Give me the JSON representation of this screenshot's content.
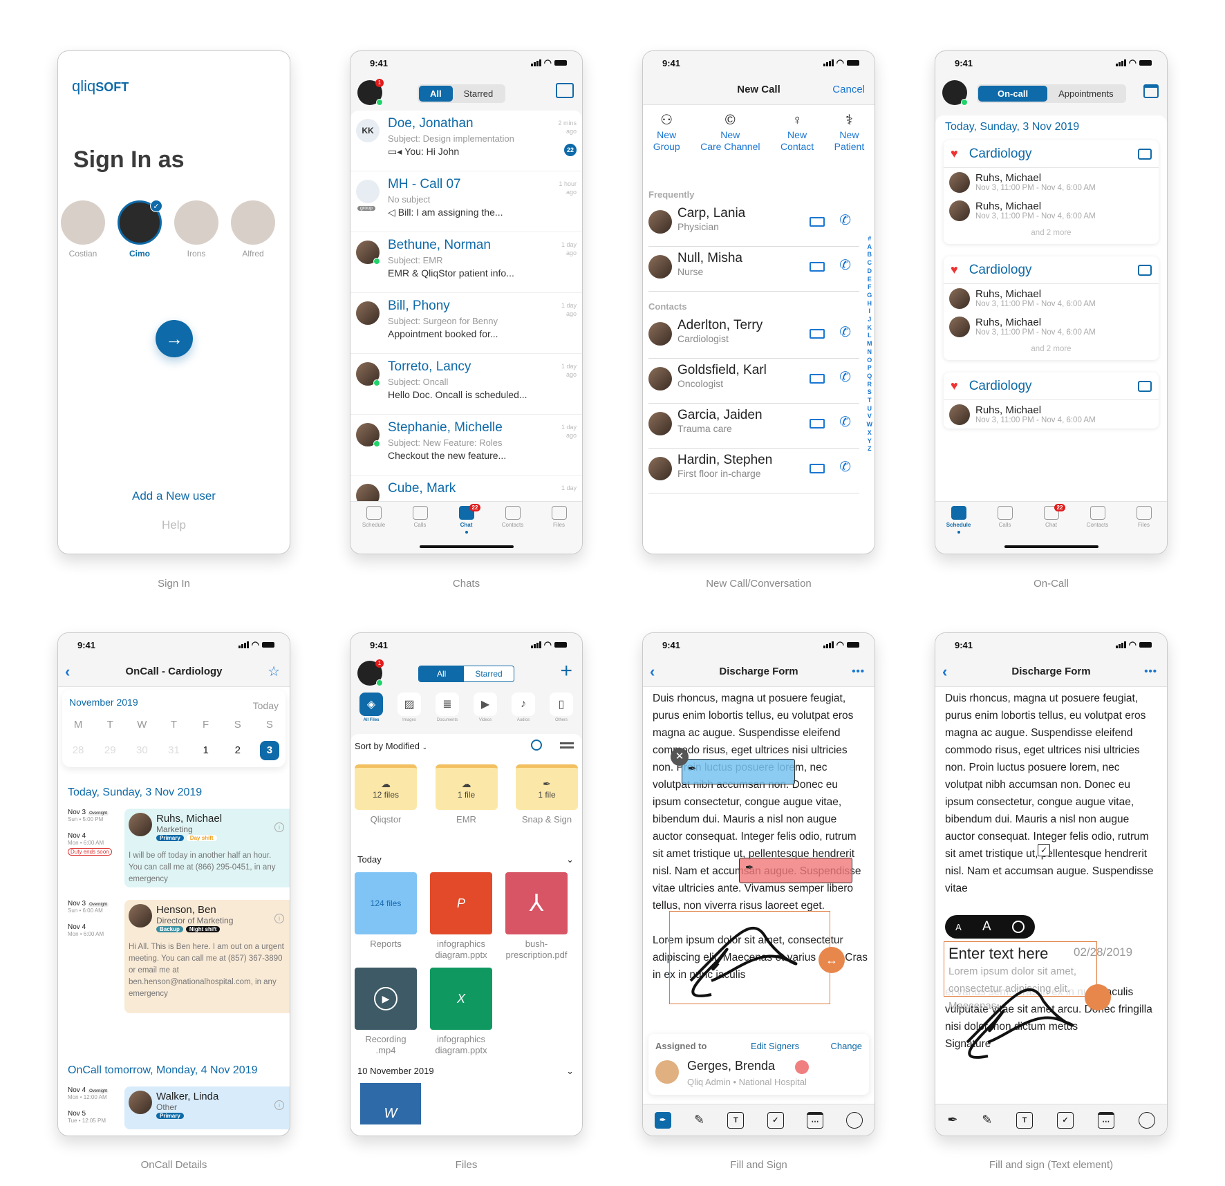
{
  "status_time": "9:41",
  "captions": [
    "Sign In",
    "Chats",
    "New Call/Conversation",
    "On-Call",
    "OnCall Details",
    "Files",
    "Fill and Sign",
    "Fill and sign (Text element)"
  ],
  "signin": {
    "logo_a": "qliq",
    "logo_b": "SOFT",
    "title": "Sign In as",
    "users": [
      {
        "name": "Costian",
        "selected": false
      },
      {
        "name": "Cimo",
        "selected": true
      },
      {
        "name": "Irons",
        "selected": false
      },
      {
        "name": "Alfred",
        "selected": false
      }
    ],
    "add_user": "Add a New user",
    "help": "Help"
  },
  "chats": {
    "seg": [
      "All",
      "Starred"
    ],
    "profile_badge": "1",
    "items": [
      {
        "name": "Doe, Jonathan",
        "initials": "KK",
        "subject": "Subject: Design implementation",
        "preview": "You: Hi John",
        "time": "2 mins ago",
        "unread": "22",
        "icon": "video"
      },
      {
        "name": "MH - Call 07",
        "initials": "",
        "subject": "No subject",
        "preview": "Bill: I am assigning the...",
        "time": "1 hour ago",
        "unread": "",
        "icon": "megaphone",
        "group_tag": "group"
      },
      {
        "name": "Bethune, Norman",
        "subject": "Subject: EMR",
        "preview": "EMR & QliqStor patient info...",
        "time": "1 day ago"
      },
      {
        "name": "Bill, Phony",
        "subject": "Subject: Surgeon for Benny",
        "preview": "Appointment booked for...",
        "time": "1 day ago"
      },
      {
        "name": "Torreto, Lancy",
        "subject": "Subject: Oncall",
        "preview": "Hello Doc. Oncall is scheduled...",
        "time": "1 day ago"
      },
      {
        "name": "Stephanie, Michelle",
        "subject": "Subject: New Feature: Roles",
        "preview": "Checkout the new feature...",
        "time": "1 day ago"
      },
      {
        "name": "Cube, Mark",
        "subject": "",
        "preview": "",
        "time": "1 day"
      }
    ],
    "tabs": [
      {
        "label": "Schedule"
      },
      {
        "label": "Calls"
      },
      {
        "label": "Chat",
        "badge": "22",
        "active": true
      },
      {
        "label": "Contacts"
      },
      {
        "label": "Files"
      }
    ]
  },
  "newcall": {
    "title": "New Call",
    "cancel": "Cancel",
    "actions": [
      [
        "New",
        "Group"
      ],
      [
        "New",
        "Care Channel"
      ],
      [
        "New",
        "Contact"
      ],
      [
        "New",
        "Patient"
      ]
    ],
    "frequently_label": "Frequently",
    "frequently": [
      {
        "name": "Carp, Lania",
        "role": "Physician"
      },
      {
        "name": "Null, Misha",
        "role": "Nurse"
      }
    ],
    "contacts_label": "Contacts",
    "contacts": [
      {
        "name": "Aderlton, Terry",
        "role": "Cardiologist"
      },
      {
        "name": "Goldsfield, Karl",
        "role": "Oncologist"
      },
      {
        "name": "Garcia, Jaiden",
        "role": "Trauma care"
      },
      {
        "name": "Hardin, Stephen",
        "role": "First floor in-charge"
      }
    ],
    "index": [
      "#",
      "A",
      "B",
      "C",
      "D",
      "E",
      "F",
      "G",
      "H",
      "I",
      "J",
      "K",
      "L",
      "M",
      "N",
      "O",
      "P",
      "Q",
      "R",
      "S",
      "T",
      "U",
      "V",
      "W",
      "X",
      "Y",
      "Z"
    ]
  },
  "oncall": {
    "seg": [
      "On-call",
      "Appointments"
    ],
    "date": "Today, Sunday, 3 Nov 2019",
    "cards": [
      {
        "dept": "Cardiology",
        "people": [
          {
            "name": "Ruhs, Michael",
            "time": "Nov 3, 11:00 PM - Nov 4, 6:00 AM"
          },
          {
            "name": "Ruhs, Michael",
            "time": "Nov 3, 11:00 PM - Nov 4, 6:00 AM"
          }
        ],
        "more": "and 2 more"
      },
      {
        "dept": "Cardiology",
        "people": [
          {
            "name": "Ruhs, Michael",
            "time": "Nov 3, 11:00 PM - Nov 4, 6:00 AM"
          },
          {
            "name": "Ruhs, Michael",
            "time": "Nov 3, 11:00 PM - Nov 4, 6:00 AM"
          }
        ],
        "more": "and 2 more"
      },
      {
        "dept": "Cardiology",
        "people": [
          {
            "name": "Ruhs, Michael",
            "time": "Nov 3, 11:00 PM - Nov 4, 6:00 AM"
          }
        ],
        "more": ""
      }
    ],
    "tabs": [
      {
        "label": "Schedule",
        "active": true
      },
      {
        "label": "Calls"
      },
      {
        "label": "Chat",
        "badge": "22"
      },
      {
        "label": "Contacts"
      },
      {
        "label": "Files"
      }
    ]
  },
  "details": {
    "title": "OnCall - Cardiology",
    "month": "November 2019",
    "today_btn": "Today",
    "weekdays": [
      "M",
      "T",
      "W",
      "T",
      "F",
      "S",
      "S"
    ],
    "days": [
      "28",
      "29",
      "30",
      "31",
      "1",
      "2",
      "3"
    ],
    "selected_day": "3",
    "today_heading": "Today, Sunday, 3 Nov 2019",
    "entries": [
      {
        "from": "Nov 3",
        "from_sub": "Sun • 5:00 PM",
        "to": "Nov 4",
        "to_sub": "Mon • 6:00 AM",
        "tag": "Overnight",
        "warn": "Duty ends soon",
        "name": "Ruhs, Michael",
        "role": "Marketing",
        "badges": [
          "Primary",
          "Day shift"
        ],
        "msg": "I will be off today in another half an hour. You can call me at (866) 295-0451, in any emergency",
        "bg": "#dff4f4"
      },
      {
        "from": "Nov 3",
        "from_sub": "Sun • 6:00 AM",
        "to": "Nov 4",
        "to_sub": "Mon • 6:00 AM",
        "tag": "Overnight",
        "warn": "",
        "name": "Henson, Ben",
        "role": "Director of Marketing",
        "badges": [
          "Backup",
          "Night shift"
        ],
        "msg": "Hi All. This is Ben here. I am out on a urgent meeting. You can call me at (857) 367-3890 or email me at ben.henson@nationalhospital.com, in any emergency",
        "bg": "#f9ead6"
      }
    ],
    "tomorrow_heading": "OnCall tomorrow, Monday, 4 Nov 2019",
    "tomorrow": {
      "from": "Nov 4",
      "from_sub": "Mon • 12:00 AM",
      "to": "Nov 5",
      "to_sub": "Tue • 12:05 PM",
      "tag": "Overnight",
      "name": "Walker, Linda",
      "role": "Other",
      "badges": [
        "Primary"
      ],
      "bg": "#d7ebfa"
    }
  },
  "files": {
    "seg": [
      "All",
      "Starred"
    ],
    "profile_badge": "1",
    "categories": [
      "All Files",
      "Images",
      "Documents",
      "Videos",
      "Audios",
      "Others"
    ],
    "sort": "Sort by Modified",
    "folders": [
      {
        "count": "12 files",
        "name": "Qliqstor"
      },
      {
        "count": "1 file",
        "name": "EMR"
      },
      {
        "count": "1 file",
        "name": "Snap & Sign"
      }
    ],
    "today_label": "Today",
    "today": [
      {
        "type": "folder",
        "count": "124 files",
        "name": "Reports"
      },
      {
        "type": "pptx",
        "letter": "P",
        "name": "infographics diagram.pptx"
      },
      {
        "type": "pdf",
        "name": "bush-prescription.pdf"
      },
      {
        "type": "video",
        "name": "Recording .mp4"
      },
      {
        "type": "xlsx",
        "letter": "X",
        "name": "infographics diagram.pptx"
      }
    ],
    "older_label": "10 November 2019",
    "older_letter": "W"
  },
  "fillsign": {
    "title": "Discharge Form",
    "paragraph1": "Duis rhoncus, magna ut posuere feugiat, purus enim lobortis tellus, eu volutpat eros magna ac augue. Suspendisse eleifend commodo risus, eget ultrices nisi ultricies non. Proin luctus posuere lorem, nec volutpat nibh accumsan non. Donec eu ipsum consectetur, congue augue vitae, bibendum dui. Mauris a nisl non augue auctor consequat. Integer felis odio, rutrum sit amet tristique ut, pellentesque hendrerit nisl. Nam et accumsan augue. Suspendisse vitae ultricies ante. Vivamus semper libero tellus, non viverra risus laoreet eget.",
    "paragraph2": "Lorem ipsum dolor sit amet, consectetur adipiscing elit. Maecenas et varius sem. Cras in ex in nunc iaculis",
    "assigned_label": "Assigned to",
    "edit_signers": "Edit Signers",
    "change": "Change",
    "signer_name": "Gerges, Brenda",
    "signer_sub": "Qliq Admin • National Hospital"
  },
  "fillsign_text": {
    "title": "Discharge Form",
    "paragraph1": "Duis rhoncus, magna ut posuere feugiat, purus enim lobortis tellus, eu volutpat eros magna ac augue. Suspendisse eleifend commodo risus, eget ultrices nisi ultricies non. Proin luctus posuere lorem, nec volutpat nibh accumsan non. Donec eu ipsum consectetur, congue augue vitae, bibendum dui. Mauris a nisl non augue auctor consequat. Integer felis odio, rutrum sit amet tristique ut, pellentesque hendrerit nisl. Nam et accumsan augue. Suspendisse vitae",
    "paragraph2": "et varius sem. Cras in ex in nunc iaculis vulputate vitae sit amet arcu. Donec fringilla nisi dolor, non dictum metus",
    "signature_label": "Signature",
    "text_placeholder": "Enter text here",
    "date": "02/28/2019",
    "text_hint": "Lorem ipsum dolor sit amet, consectetur adipiscing elit. Maecenas",
    "font_small": "A",
    "font_large": "A"
  }
}
